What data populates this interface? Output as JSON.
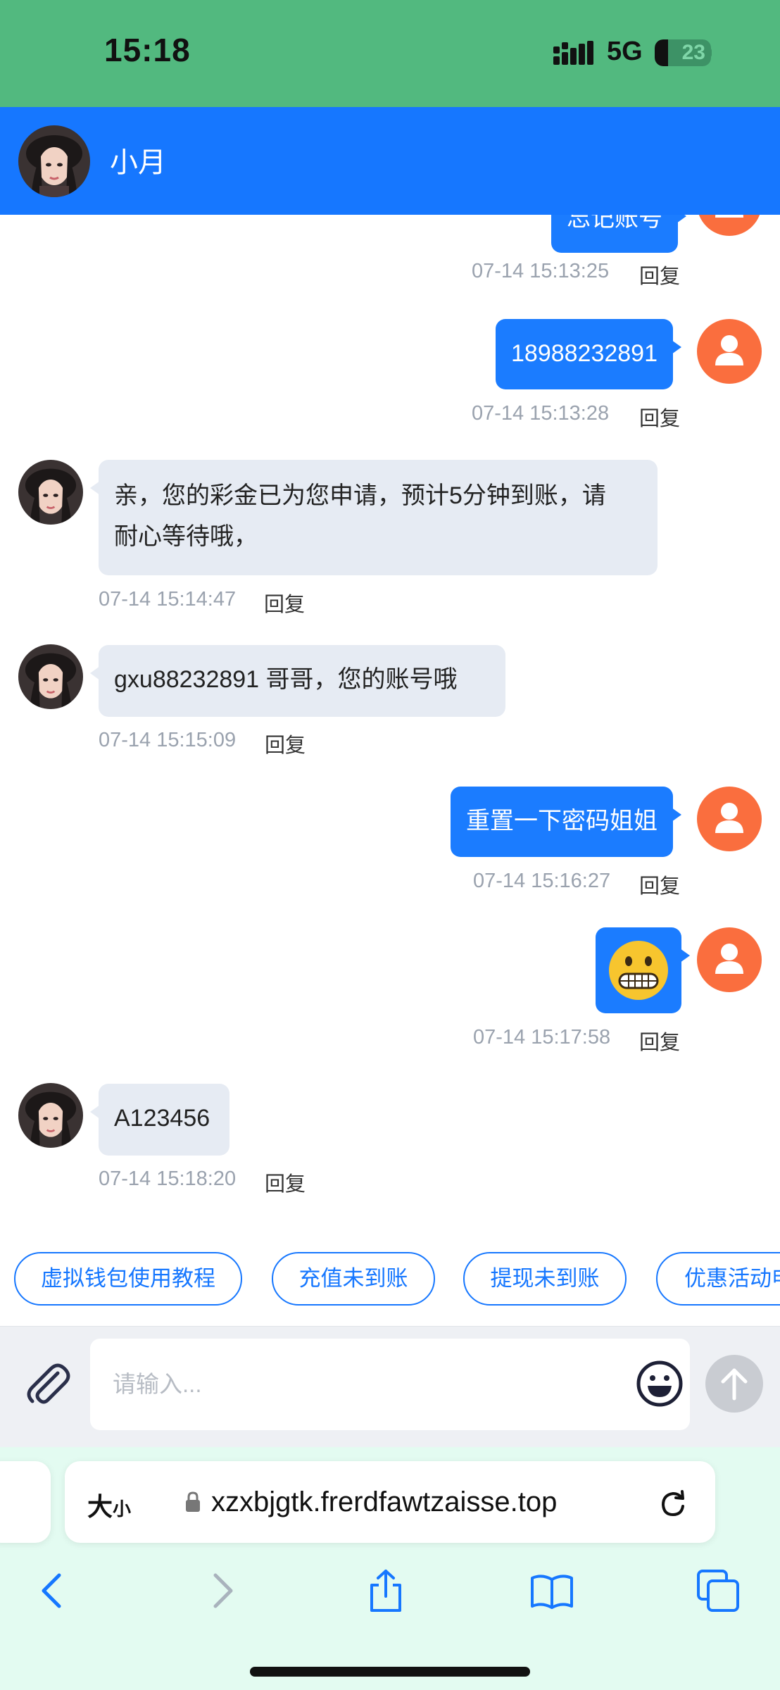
{
  "status_bar": {
    "time": "15:18",
    "network": "5G",
    "battery": "23"
  },
  "header": {
    "contact_name": "小月"
  },
  "messages": [
    {
      "direction": "out",
      "text": "忘记账号",
      "timestamp": "07-14 15:13:25",
      "reply": "回复"
    },
    {
      "direction": "out",
      "text": "18988232891",
      "timestamp": "07-14 15:13:28",
      "reply": "回复"
    },
    {
      "direction": "in",
      "line1": "亲，您的彩金已为您申请，预计5分钟到账，请",
      "line2": "耐心等待哦，",
      "timestamp": "07-14 15:14:47",
      "reply": "回复"
    },
    {
      "direction": "in",
      "text": "gxu88232891  哥哥，您的账号哦",
      "timestamp": "07-14 15:15:09",
      "reply": "回复"
    },
    {
      "direction": "out",
      "text": "重置一下密码姐姐",
      "timestamp": "07-14 15:16:27",
      "reply": "回复"
    },
    {
      "direction": "out",
      "emoji": "😬",
      "timestamp": "07-14 15:17:58",
      "reply": "回复"
    },
    {
      "direction": "in",
      "text": "A123456",
      "timestamp": "07-14 15:18:20",
      "reply": "回复"
    }
  ],
  "quick_replies": [
    "虚拟钱包使用教程",
    "充值未到账",
    "提现未到账",
    "优惠活动申"
  ],
  "input": {
    "placeholder": "请输入..."
  },
  "browser": {
    "text_size_big": "大",
    "text_size_small": "小",
    "url": "xzxbjgtk.frerdfawtzaisse.top"
  },
  "colors": {
    "header": "#1677ff",
    "status_bar": "#52b97f",
    "outgoing_bubble": "#1b7cff",
    "incoming_bubble": "#e6ebf3",
    "user_avatar": "#fa6e3e"
  },
  "icons": [
    "signal-icon",
    "battery-icon",
    "paperclip-icon",
    "smiley-icon",
    "send-arrow-icon",
    "lock-icon",
    "reload-icon",
    "back-icon",
    "forward-icon",
    "share-icon",
    "bookmarks-icon",
    "tabs-icon"
  ]
}
